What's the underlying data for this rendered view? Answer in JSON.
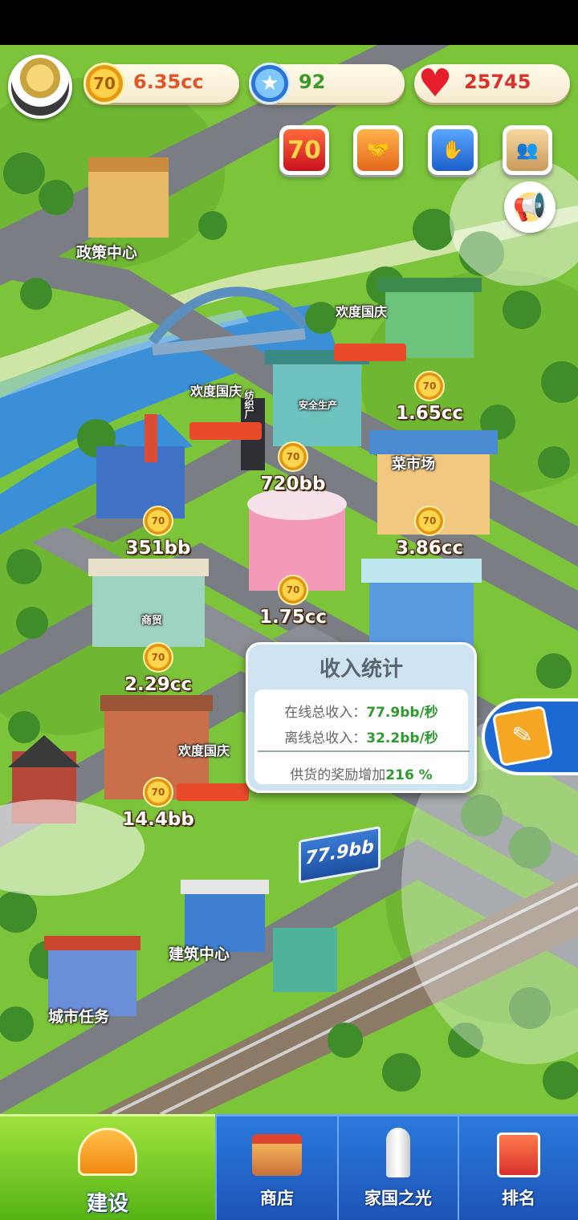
{
  "resources": {
    "coins": "6.35cc",
    "coin_icon_text": "70",
    "gems": "92",
    "hearts": "25745"
  },
  "event_buttons": [
    {
      "name": "anniversary-70",
      "text": "70"
    },
    {
      "name": "handshake"
    },
    {
      "name": "hand-emblem"
    },
    {
      "name": "team-photo"
    }
  ],
  "map_labels": {
    "policy_center": "政策中心",
    "construction_center": "建筑中心",
    "city_tasks": "城市任务"
  },
  "buildings": [
    {
      "id": "food-factory",
      "income": "1.65cc"
    },
    {
      "id": "textile-mill",
      "income": "720bb"
    },
    {
      "id": "power-plant",
      "income": "351bb"
    },
    {
      "id": "vegetable-market",
      "income": "3.86cc"
    },
    {
      "id": "restaurant",
      "income": "1.75cc"
    },
    {
      "id": "trade-mall",
      "income": "2.29cc"
    },
    {
      "id": "residential",
      "income": "14.4bb"
    }
  ],
  "coin_marker_text": "70",
  "income_popup": {
    "title": "收入统计",
    "online_label": "在线总收入：",
    "online_value": "77.9bb/秒",
    "offline_label": "离线总收入：",
    "offline_value": "32.2bb/秒",
    "bonus_label": "供货的奖励增加",
    "bonus_value": "216 %"
  },
  "billboard": "77.9bb",
  "signs": {
    "textile": "纺织厂",
    "market": "菜市场",
    "safety": "安全生产",
    "mall": "商贸",
    "celebration": "欢度国庆"
  },
  "nav": {
    "build": "建设",
    "shop": "商店",
    "homeland": "家国之光",
    "rank": "排名"
  },
  "colors": {
    "grass": "#7cc43a",
    "road": "#7a7e84",
    "river": "#3a8fd6",
    "nav_active": "#6cc21e",
    "nav_normal": "#1f5fc4",
    "popup_green": "#2f9a2f"
  }
}
